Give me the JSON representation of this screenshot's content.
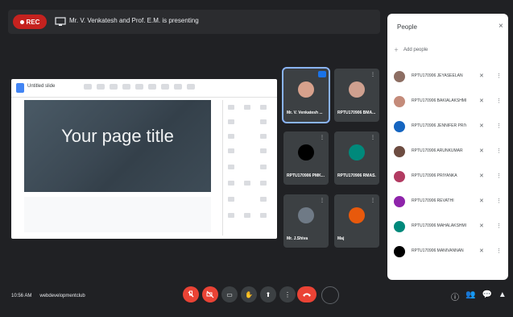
{
  "topbar": {
    "rec_label": "REC",
    "presenting_text": "Mr. V. Venkatesh and Prof. E.M. is presenting"
  },
  "slide": {
    "doc_title": "Untitled slide",
    "title_text": "Your page title"
  },
  "tiles": [
    {
      "name": "Mr. V. Venkatesh ...",
      "avatar_color": "#d7a18c",
      "active": true
    },
    {
      "name": "RPTU170906 BMA...",
      "avatar_color": "#cfa08f",
      "active": false
    },
    {
      "name": "RPTU170906 PMK...",
      "avatar_color": "#000000",
      "active": false
    },
    {
      "name": "RPTU170906 RMAS...",
      "avatar_color": "#00897b",
      "active": false
    },
    {
      "name": "Mr. J.Shiva",
      "avatar_color": "#6f7a86",
      "active": false
    },
    {
      "name": "Maj",
      "avatar_color": "#e8590c",
      "active": false
    }
  ],
  "people_panel": {
    "title": "People",
    "add_label": "Add people",
    "people": [
      {
        "name": "RPTU170906 JEYASEELAN",
        "color": "#8d6e63"
      },
      {
        "name": "RPTU170906 BAKIALAKSHMI",
        "color": "#c48b7a"
      },
      {
        "name": "RPTU170906 JENNIFER PRIYA",
        "color": "#1565c0"
      },
      {
        "name": "RPTU170906 ARUNKUMAR",
        "color": "#6d4c41"
      },
      {
        "name": "RPTU170906 PRIYANKA",
        "color": "#b23b62"
      },
      {
        "name": "RPTU170906 REVATHI",
        "color": "#8e24aa"
      },
      {
        "name": "RPTU170906 MAHALAKSHMI",
        "color": "#00897b"
      },
      {
        "name": "RPTU170906 MANIVANNAN",
        "color": "#000000"
      }
    ]
  },
  "footer": {
    "time": "10:56 AM",
    "meeting_code": "webdevelopmentclub"
  }
}
